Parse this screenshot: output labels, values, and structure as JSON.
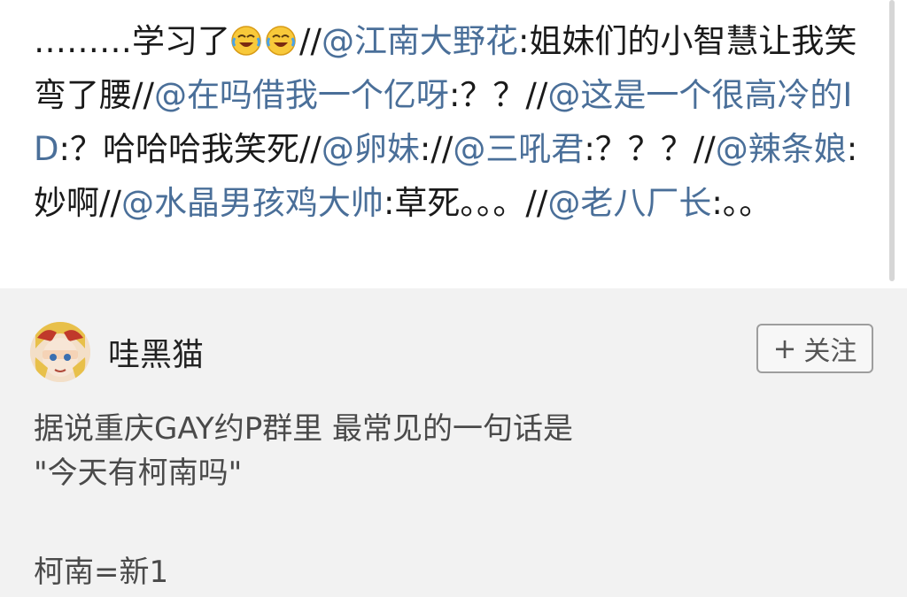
{
  "repost": {
    "prefix": "………学习了",
    "emoji_icon": "laughing-crying-face-icon",
    "segments": [
      {
        "type": "sep",
        "text": "//"
      },
      {
        "type": "mention",
        "text": "@江南大野花"
      },
      {
        "type": "text",
        "text": ":姐妹们的小智慧让我笑弯了腰"
      },
      {
        "type": "sep",
        "text": "//"
      },
      {
        "type": "mention",
        "text": "@在吗借我一个亿呀"
      },
      {
        "type": "text",
        "text": ":？？"
      },
      {
        "type": "sep",
        "text": "//"
      },
      {
        "type": "mention",
        "text": "@这是一个很高冷的ID"
      },
      {
        "type": "text",
        "text": ":？哈哈哈我笑死"
      },
      {
        "type": "sep",
        "text": "//"
      },
      {
        "type": "mention",
        "text": "@卵妹"
      },
      {
        "type": "text",
        "text": ":"
      },
      {
        "type": "sep",
        "text": "//"
      },
      {
        "type": "mention",
        "text": "@三吼君"
      },
      {
        "type": "text",
        "text": ":？？？"
      },
      {
        "type": "sep",
        "text": "//"
      },
      {
        "type": "mention",
        "text": "@辣条娘"
      },
      {
        "type": "text",
        "text": ":妙啊"
      },
      {
        "type": "sep",
        "text": "//"
      },
      {
        "type": "mention",
        "text": "@水晶男孩鸡大帅"
      },
      {
        "type": "text",
        "text": ":草死。。。"
      },
      {
        "type": "sep",
        "text": "//"
      },
      {
        "type": "mention",
        "text": "@老八厂长"
      },
      {
        "type": "text",
        "text": ":。。"
      }
    ]
  },
  "post": {
    "username": "哇黑猫",
    "follow_label": "关注",
    "follow_icon": "plus-icon",
    "body_lines": [
      "据说重庆GAY约P群里 最常见的一句话是",
      "\"今天有柯南吗\"",
      "",
      "柯南=新1"
    ]
  },
  "colors": {
    "mention": "#4a6f99",
    "text": "#1a1a1a",
    "post_text": "#4a4a4a",
    "post_bg": "#f2f2f2",
    "repost_bg": "#ffffff"
  }
}
